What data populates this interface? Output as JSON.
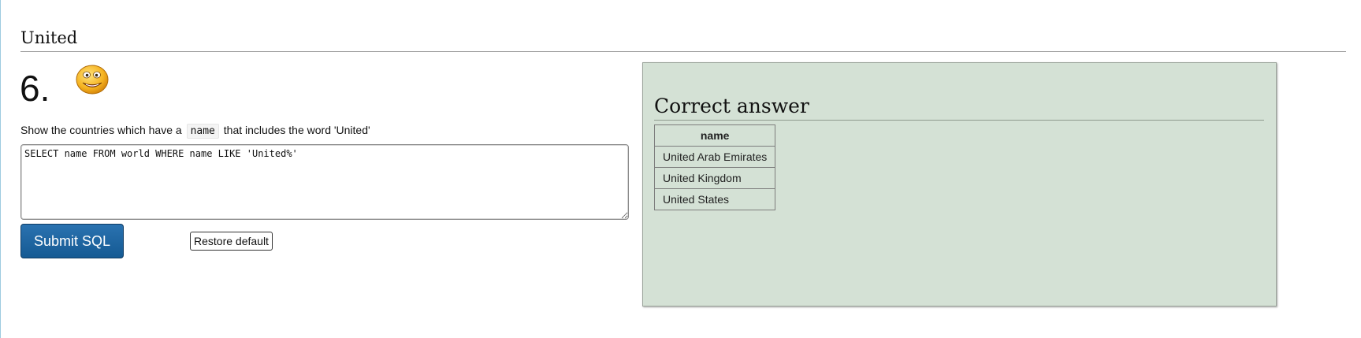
{
  "section": {
    "title": "United"
  },
  "question": {
    "number": "6.",
    "icon": "smiley-face-icon",
    "text_before": "Show the countries which have a",
    "code": "name",
    "text_after": "that includes the word 'United'"
  },
  "editor": {
    "value": "SELECT name FROM world WHERE name LIKE 'United%'"
  },
  "buttons": {
    "submit_label": "Submit SQL",
    "restore_label": "Restore default"
  },
  "answer": {
    "title": "Correct answer",
    "columns": [
      "name"
    ],
    "rows": [
      [
        "United Arab Emirates"
      ],
      [
        "United Kingdom"
      ],
      [
        "United States"
      ]
    ]
  },
  "colors": {
    "panel_bg": "#d4e1d5",
    "submit_bg": "#155a93"
  }
}
